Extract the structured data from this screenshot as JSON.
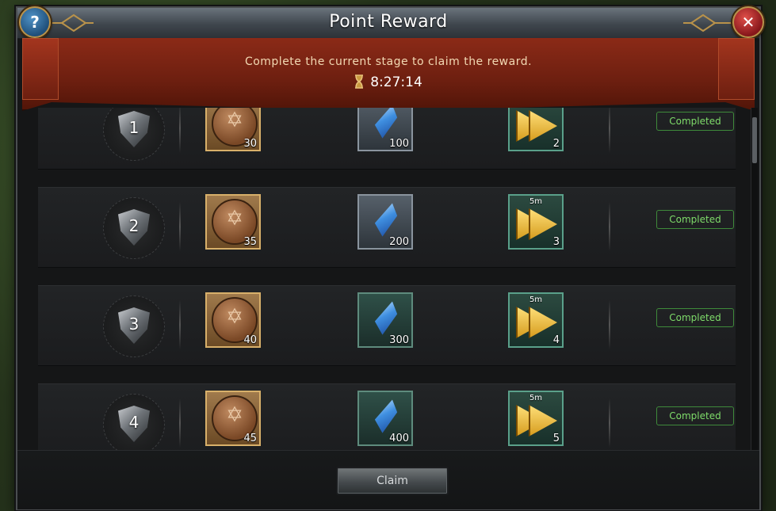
{
  "window": {
    "title": "Point Reward",
    "help_glyph": "?",
    "close_glyph": "✕"
  },
  "banner": {
    "message": "Complete the current stage to claim the reward.",
    "timer": "8:27:14"
  },
  "rows": [
    {
      "rank": "1",
      "coin_qty": "30",
      "crystal_qty": "100",
      "crystal_style": "grey",
      "speedup_tag": "",
      "speedup_qty": "2",
      "status": "Completed"
    },
    {
      "rank": "2",
      "coin_qty": "35",
      "crystal_qty": "200",
      "crystal_style": "grey",
      "speedup_tag": "5m",
      "speedup_qty": "3",
      "status": "Completed"
    },
    {
      "rank": "3",
      "coin_qty": "40",
      "crystal_qty": "300",
      "crystal_style": "teal",
      "speedup_tag": "5m",
      "speedup_qty": "4",
      "status": "Completed"
    },
    {
      "rank": "4",
      "coin_qty": "45",
      "crystal_qty": "400",
      "crystal_style": "teal",
      "speedup_tag": "5m",
      "speedup_qty": "5",
      "status": "Completed"
    }
  ],
  "footer": {
    "claim_label": "Claim"
  },
  "icons": {
    "coin": "hexagram-coin-icon",
    "crystal": "blue-crystal-icon",
    "speedup": "gold-arrows-speedup-icon",
    "rank": "shield-icon",
    "timer": "hourglass-icon"
  },
  "colors": {
    "banner": "#7a2412",
    "status_green": "#7fdc6a",
    "help_blue": "#2f6fa3",
    "close_red": "#b32024"
  }
}
